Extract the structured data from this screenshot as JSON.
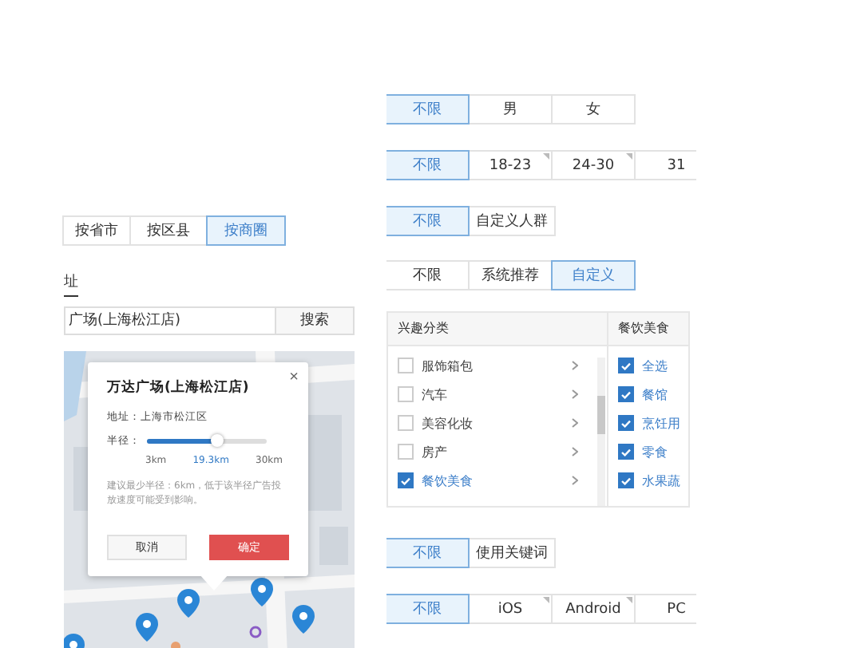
{
  "area_tabs": [
    {
      "label": "按省市",
      "selected": false
    },
    {
      "label": "按区县",
      "selected": false
    },
    {
      "label": "按商圈",
      "selected": true
    }
  ],
  "address_label": "址",
  "search": {
    "value": "广场(上海松江店)",
    "button": "搜索"
  },
  "map": {
    "kind": "picture",
    "popup": {
      "close": "×",
      "title": "万达广场(上海松江店)",
      "address_label": "地址：",
      "address": "上海市松江区",
      "radius_label": "半径：",
      "level": 0.59,
      "ticks": [
        "3km",
        "19.3km",
        "30km"
      ],
      "note": "建议最少半径：6km，低于该半径广告投放速度可能受到影响。",
      "cancel": "取消",
      "confirm": "确定"
    }
  },
  "gender": [
    {
      "label": "不限",
      "selected": true,
      "hint": false
    },
    {
      "label": "男",
      "selected": false,
      "hint": false
    },
    {
      "label": "女",
      "selected": false,
      "hint": false
    }
  ],
  "age": [
    {
      "label": "不限",
      "selected": true,
      "hint": false
    },
    {
      "label": "18-23",
      "selected": false,
      "hint": true
    },
    {
      "label": "24-30",
      "selected": false,
      "hint": true
    },
    {
      "label": "31",
      "selected": false,
      "hint": false
    }
  ],
  "crowd": [
    {
      "label": "不限",
      "selected": true,
      "hint": false
    },
    {
      "label": "自定义人群",
      "selected": false,
      "hint": false
    }
  ],
  "interest": [
    {
      "label": "不限",
      "selected": false,
      "hint": false
    },
    {
      "label": "系统推荐",
      "selected": false,
      "hint": false
    },
    {
      "label": "自定义",
      "selected": true,
      "hint": false
    }
  ],
  "interest_table": {
    "category_header": "兴趣分类",
    "categories": [
      {
        "label": "服饰箱包",
        "checked": false
      },
      {
        "label": "汽车",
        "checked": false
      },
      {
        "label": "美容化妆",
        "checked": false
      },
      {
        "label": "房产",
        "checked": false
      },
      {
        "label": "餐饮美食",
        "checked": true
      }
    ],
    "sub_header": "餐饮美食",
    "subs": [
      {
        "label": "全选",
        "checked": true
      },
      {
        "label": "餐馆",
        "checked": true
      },
      {
        "label": "烹饪用",
        "checked": true
      },
      {
        "label": "零食",
        "checked": true
      },
      {
        "label": "水果蔬",
        "checked": true
      }
    ]
  },
  "keyword": [
    {
      "label": "不限",
      "selected": true,
      "hint": false
    },
    {
      "label": "使用关键词",
      "selected": false,
      "hint": false
    }
  ],
  "os": [
    {
      "label": "不限",
      "selected": true,
      "hint": false
    },
    {
      "label": "iOS",
      "selected": false,
      "hint": true
    },
    {
      "label": "Android",
      "selected": false,
      "hint": true
    },
    {
      "label": "PC",
      "selected": false,
      "hint": false
    }
  ]
}
